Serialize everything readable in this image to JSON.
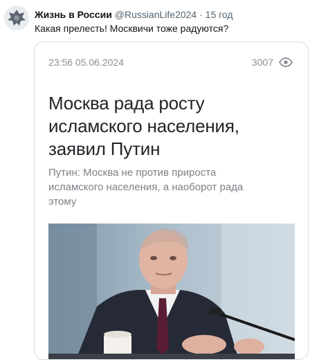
{
  "tweet": {
    "author": "Жизнь в России",
    "handle": "@RussianLife2024",
    "separator": "·",
    "time": "15 год",
    "text": "Какая прелесть! Москвичи тоже радуются?",
    "avatar_icon": "emblem-icon"
  },
  "card": {
    "datetime": "23:56 05.06.2024",
    "views": "3007",
    "views_icon": "eye-icon",
    "headline": "Москва рада росту исламского населения, заявил Путин",
    "subtitle": "Путин: Москва не против прироста исламского населения, а наоборот рада этому"
  },
  "colors": {
    "text_primary": "#0f1419",
    "text_secondary": "#536471",
    "card_border": "#d6dadd",
    "meta_gray": "#8a8f95"
  }
}
